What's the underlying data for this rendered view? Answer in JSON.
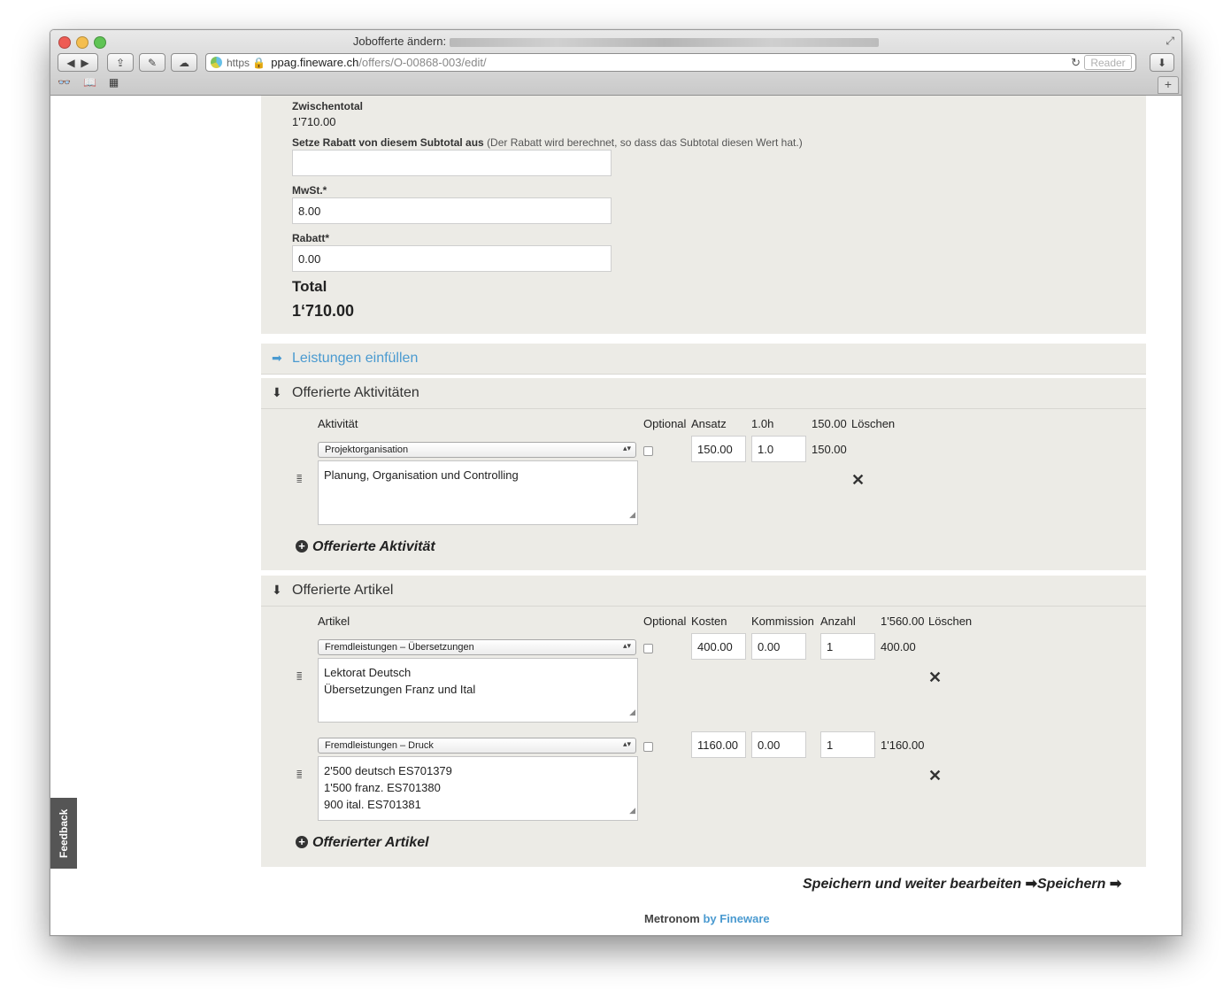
{
  "browser": {
    "title": "Jobofferte ändern:",
    "url_scheme": "https",
    "url_host": "ppag.fineware.ch",
    "url_path": "/offers/O-00868-003/edit/",
    "reader_label": "Reader",
    "newtab_label": "+"
  },
  "totals": {
    "subtotal_label": "Zwischentotal",
    "subtotal_value": "1'710.00",
    "discount_from_label": "Setze Rabatt von diesem Subtotal aus",
    "discount_from_hint": "(Der Rabatt wird berechnet, so dass das Subtotal diesen Wert hat.)",
    "discount_from_value": "",
    "vat_label": "MwSt.*",
    "vat_value": "8.00",
    "discount_label": "Rabatt*",
    "discount_value": "0.00",
    "total_label": "Total",
    "total_value": "1‘710.00"
  },
  "fill_services": {
    "label": "Leistungen einfüllen"
  },
  "activities": {
    "header": "Offerierte Aktivitäten",
    "col_activity": "Aktivität",
    "col_optional": "Optional",
    "col_rate": "Ansatz",
    "col_hours": "1.0h",
    "col_sum": "150.00",
    "col_delete": "Löschen",
    "rows": [
      {
        "activity": "Projektorganisation",
        "rate": "150.00",
        "hours": "1.0",
        "total": "150.00",
        "description": "Planung, Organisation und Controlling"
      }
    ],
    "add_label": "Offerierte Aktivität"
  },
  "articles": {
    "header": "Offerierte Artikel",
    "col_article": "Artikel",
    "col_optional": "Optional",
    "col_cost": "Kosten",
    "col_commission": "Kommission",
    "col_count": "Anzahl",
    "col_sum": "1'560.00",
    "col_delete": "Löschen",
    "rows": [
      {
        "article": "Fremdleistungen – Übersetzungen",
        "cost": "400.00",
        "commission": "0.00",
        "count": "1",
        "total": "400.00",
        "description": "Lektorat Deutsch\nÜbersetzungen Franz und Ital"
      },
      {
        "article": "Fremdleistungen – Druck",
        "cost": "1160.00",
        "commission": "0.00",
        "count": "1",
        "total": "1'160.00",
        "description": "2'500 deutsch ES701379\n1'500 franz. ES701380\n900 ital. ES701381"
      }
    ],
    "add_label": "Offerierter Artikel"
  },
  "actions": {
    "save_continue": "Speichern und weiter bearbeiten",
    "save": "Speichern"
  },
  "footer": {
    "brand": "Metronom",
    "by": "by Fineware"
  },
  "feedback_label": "Feedback",
  "colors": {
    "link": "#4a9ad0",
    "panel": "#ecebe6"
  }
}
